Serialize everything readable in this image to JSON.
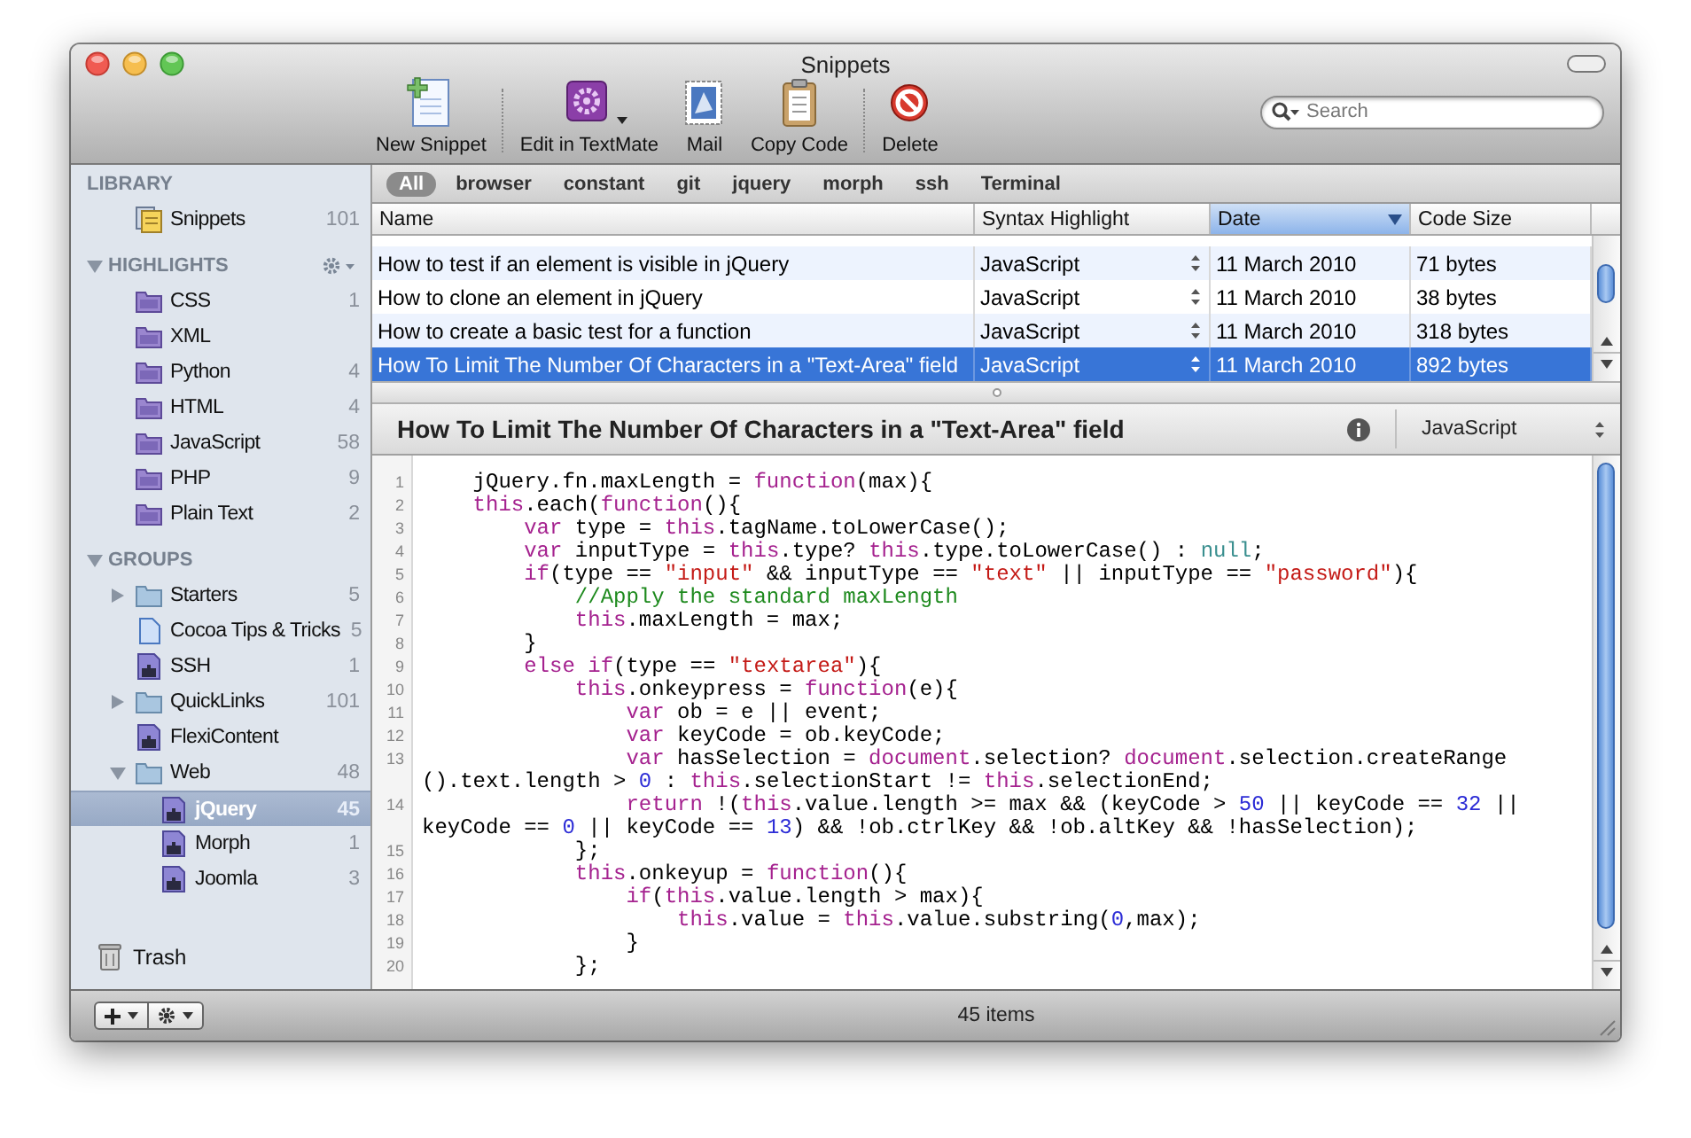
{
  "window": {
    "title": "Snippets"
  },
  "toolbar": {
    "groups": [
      [
        {
          "label": "New Snippet"
        }
      ],
      [
        {
          "label": "Edit in TextMate",
          "menu": true
        },
        {
          "label": "Mail"
        },
        {
          "label": "Copy Code"
        }
      ],
      [
        {
          "label": "Delete"
        }
      ]
    ],
    "search": {
      "placeholder": "Search"
    }
  },
  "sidebar": {
    "sections": [
      {
        "heading": "LIBRARY",
        "items": [
          {
            "label": "Snippets",
            "count": "101",
            "kind": "library",
            "selected": false
          }
        ]
      },
      {
        "heading": "HIGHLIGHTS",
        "expanded": true,
        "menu": true,
        "items": [
          {
            "label": "CSS",
            "count": "1",
            "kind": "syntax",
            "selected": false
          },
          {
            "label": "XML",
            "kind": "syntax",
            "selected": false
          },
          {
            "label": "Python",
            "count": "4",
            "kind": "syntax",
            "selected": false
          },
          {
            "label": "HTML",
            "count": "4",
            "kind": "syntax",
            "selected": false
          },
          {
            "label": "JavaScript",
            "count": "58",
            "kind": "syntax",
            "selected": false
          },
          {
            "label": "PHP",
            "count": "9",
            "kind": "syntax",
            "selected": false
          },
          {
            "label": "Plain Text",
            "count": "2",
            "kind": "syntax",
            "selected": false
          }
        ]
      },
      {
        "heading": "GROUPS",
        "expanded": true,
        "items": [
          {
            "label": "Starters",
            "count": "5",
            "kind": "folder",
            "expanded": false,
            "selected": false
          },
          {
            "label": "Cocoa Tips & Tricks",
            "count": "5",
            "kind": "document",
            "selected": false
          },
          {
            "label": "SSH",
            "count": "1",
            "kind": "group",
            "selected": false
          },
          {
            "label": "QuickLinks",
            "count": "101",
            "kind": "folder",
            "expanded": false,
            "selected": false
          },
          {
            "label": "FlexiContent",
            "kind": "group",
            "selected": false
          },
          {
            "label": "Web",
            "count": "48",
            "kind": "folder",
            "expanded": true,
            "selected": false,
            "children": [
              {
                "label": "jQuery",
                "count": "45",
                "kind": "group",
                "selected": true
              },
              {
                "label": "Morph",
                "count": "1",
                "kind": "group",
                "selected": false
              },
              {
                "label": "Joomla",
                "count": "3",
                "kind": "group",
                "selected": false
              }
            ]
          }
        ]
      }
    ],
    "trash": {
      "label": "Trash"
    }
  },
  "tags": [
    {
      "label": "All",
      "selected": true
    },
    {
      "label": "browser",
      "selected": false
    },
    {
      "label": "constant",
      "selected": false
    },
    {
      "label": "git",
      "selected": false
    },
    {
      "label": "jquery",
      "selected": false
    },
    {
      "label": "morph",
      "selected": false
    },
    {
      "label": "ssh",
      "selected": false
    },
    {
      "label": "Terminal",
      "selected": false
    }
  ],
  "table": {
    "columns": [
      {
        "label": "Name",
        "sorted": false
      },
      {
        "label": "Syntax Highlight",
        "sorted": false
      },
      {
        "label": "Date",
        "sorted": true
      },
      {
        "label": "Code Size",
        "sorted": false
      }
    ],
    "rows": [
      {
        "name": "How to test if an element is visible in jQuery",
        "syntax": "JavaScript",
        "date": "11 March 2010",
        "size": "71 bytes",
        "selected": false
      },
      {
        "name": "How to clone an element in jQuery",
        "syntax": "JavaScript",
        "date": "11 March 2010",
        "size": "38 bytes",
        "selected": false
      },
      {
        "name": "How to create a basic test for a function",
        "syntax": "JavaScript",
        "date": "11 March 2010",
        "size": "318 bytes",
        "selected": false
      },
      {
        "name": "How To Limit The Number Of Characters in a \"Text-Area\" field",
        "syntax": "JavaScript",
        "date": "11 March 2010",
        "size": "892 bytes",
        "selected": true
      }
    ]
  },
  "detail": {
    "title": "How To Limit The Number Of Characters in a \"Text-Area\" field",
    "syntax": "JavaScript",
    "code": [
      {
        "number": "1",
        "rows": [
          [
            "    jQuery.fn.maxLength = ",
            {
              "kind": "keyword",
              "text": "function"
            },
            "(max){"
          ]
        ]
      },
      {
        "number": "2",
        "rows": [
          [
            {
              "kind": "keyword",
              "text": "    this"
            },
            ".each(",
            {
              "kind": "keyword",
              "text": "function"
            },
            "(){"
          ]
        ]
      },
      {
        "number": "3",
        "rows": [
          [
            {
              "kind": "keyword",
              "text": "        var"
            },
            " type = ",
            {
              "kind": "keyword",
              "text": "this"
            },
            ".tagName.toLowerCase();"
          ]
        ]
      },
      {
        "number": "4",
        "rows": [
          [
            {
              "kind": "keyword",
              "text": "        var"
            },
            " inputType = ",
            {
              "kind": "keyword",
              "text": "this"
            },
            ".type? ",
            {
              "kind": "keyword",
              "text": "this"
            },
            ".type.toLowerCase() : ",
            {
              "kind": "constant",
              "text": "null"
            },
            ";"
          ]
        ]
      },
      {
        "number": "5",
        "rows": [
          [
            {
              "kind": "keyword",
              "text": "        if"
            },
            "(type == ",
            {
              "kind": "string",
              "text": "\"input\""
            },
            " && inputType == ",
            {
              "kind": "string",
              "text": "\"text\""
            },
            " || inputType == ",
            {
              "kind": "string",
              "text": "\"password\""
            },
            "){"
          ]
        ]
      },
      {
        "number": "6",
        "rows": [
          [
            {
              "kind": "comment",
              "text": "            //Apply the standard maxLength"
            }
          ]
        ]
      },
      {
        "number": "7",
        "rows": [
          [
            {
              "kind": "keyword",
              "text": "            this"
            },
            ".maxLength = max;"
          ]
        ]
      },
      {
        "number": "8",
        "rows": [
          [
            "        }"
          ]
        ]
      },
      {
        "number": "9",
        "rows": [
          [
            {
              "kind": "keyword",
              "text": "        else if"
            },
            "(type == ",
            {
              "kind": "string",
              "text": "\"textarea\""
            },
            "){"
          ]
        ]
      },
      {
        "number": "10",
        "rows": [
          [
            {
              "kind": "keyword",
              "text": "            this"
            },
            ".onkeypress = ",
            {
              "kind": "keyword",
              "text": "function"
            },
            "(e){"
          ]
        ]
      },
      {
        "number": "11",
        "rows": [
          [
            {
              "kind": "keyword",
              "text": "                var"
            },
            " ob = e || event;"
          ]
        ]
      },
      {
        "number": "12",
        "rows": [
          [
            {
              "kind": "keyword",
              "text": "                var"
            },
            " keyCode = ob.keyCode;"
          ]
        ]
      },
      {
        "number": "13",
        "rows": [
          {
            "tokens": [
              {
                "kind": "keyword",
                "text": "                var"
              },
              " hasSelection = ",
              {
                "kind": "keyword",
                "text": "document"
              },
              ".selection? ",
              {
                "kind": "keyword",
                "text": "document"
              },
              ".selection.createRange"
            ]
          },
          {
            "tokens": [
              "().text.length > ",
              {
                "kind": "number",
                "text": "0"
              },
              " : ",
              {
                "kind": "keyword",
                "text": "this"
              },
              ".selectionStart != ",
              {
                "kind": "keyword",
                "text": "this"
              },
              ".selectionEnd;"
            ]
          }
        ]
      },
      {
        "number": "14",
        "rows": [
          {
            "tokens": [
              {
                "kind": "keyword",
                "text": "                return"
              },
              " !(",
              {
                "kind": "keyword",
                "text": "this"
              },
              ".value.length >= max && (keyCode > ",
              {
                "kind": "number",
                "text": "50"
              },
              " || keyCode == ",
              {
                "kind": "number",
                "text": "32"
              },
              " ||"
            ]
          },
          {
            "tokens": [
              "keyCode == ",
              {
                "kind": "number",
                "text": "0"
              },
              " || keyCode == ",
              {
                "kind": "number",
                "text": "13"
              },
              ") && !ob.ctrlKey && !ob.altKey && !hasSelection);"
            ]
          }
        ]
      },
      {
        "number": "15",
        "rows": [
          [
            "            };"
          ]
        ]
      },
      {
        "number": "16",
        "rows": [
          [
            {
              "kind": "keyword",
              "text": "            this"
            },
            ".onkeyup = ",
            {
              "kind": "keyword",
              "text": "function"
            },
            "(){"
          ]
        ]
      },
      {
        "number": "17",
        "rows": [
          [
            {
              "kind": "keyword",
              "text": "                if"
            },
            "(",
            {
              "kind": "keyword",
              "text": "this"
            },
            ".value.length > max){"
          ]
        ]
      },
      {
        "number": "18",
        "rows": [
          [
            {
              "kind": "keyword",
              "text": "                    this"
            },
            ".value = ",
            {
              "kind": "keyword",
              "text": "this"
            },
            ".value.substring(",
            {
              "kind": "number",
              "text": "0"
            },
            ",max);"
          ]
        ]
      },
      {
        "number": "19",
        "rows": [
          [
            "                }"
          ]
        ]
      },
      {
        "number": "20",
        "rows": [
          [
            "            };"
          ]
        ]
      }
    ]
  },
  "status_bar": {
    "text": "45 items"
  }
}
